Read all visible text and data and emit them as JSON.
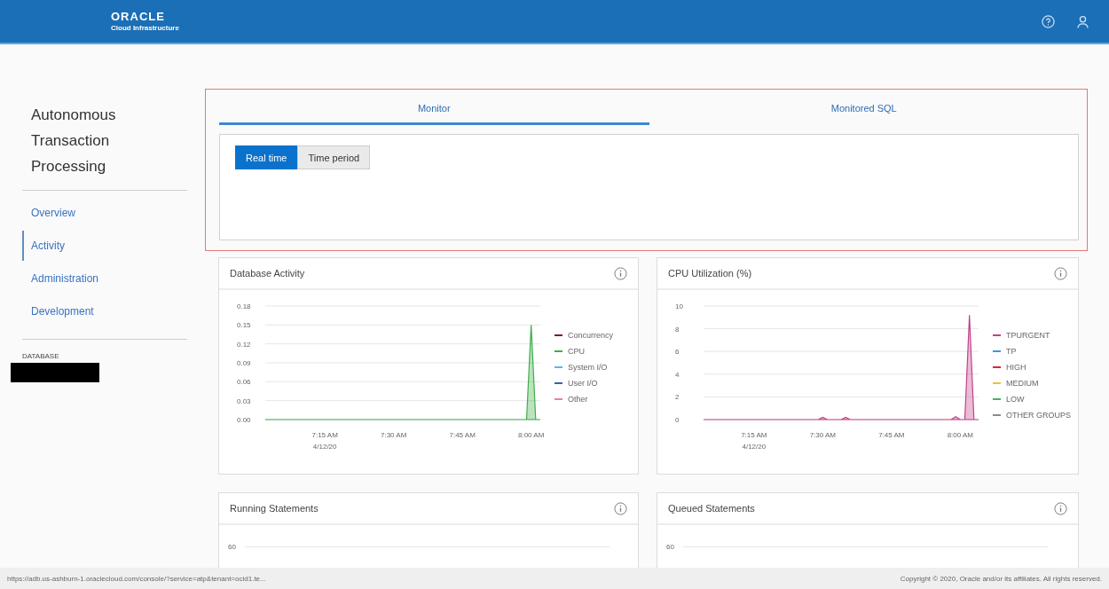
{
  "header": {
    "logo": "ORACLE",
    "logo_subtitle": "Cloud Infrastructure"
  },
  "sidebar": {
    "title": "Autonomous Transaction Processing",
    "items": [
      {
        "label": "Overview",
        "selected": false
      },
      {
        "label": "Activity",
        "selected": true
      },
      {
        "label": "Administration",
        "selected": false
      },
      {
        "label": "Development",
        "selected": false
      }
    ],
    "database_label": "DATABASE"
  },
  "tabs": [
    {
      "label": "Monitor",
      "selected": true
    },
    {
      "label": "Monitored SQL",
      "selected": false
    }
  ],
  "mode_buttons": [
    {
      "label": "Real time",
      "selected": true
    },
    {
      "label": "Time period",
      "selected": false
    }
  ],
  "charts": [
    {
      "title": "Database Activity",
      "date_label": "4/12/20",
      "legend": [
        {
          "kind": "static",
          "label": "Concurrency",
          "color": "#7a1f1f"
        },
        {
          "kind": "series"
        },
        {
          "kind": "static",
          "label": "System I/O",
          "color": "#5ab4e6"
        },
        {
          "kind": "static",
          "label": "User I/O",
          "color": "#3c5fb0"
        },
        {
          "kind": "static",
          "label": "Other",
          "color": "#e8829c"
        }
      ],
      "chart_data": {
        "type": "area",
        "grid": true,
        "ylim": [
          0,
          0.18
        ],
        "yticks": [
          {
            "value": 0,
            "label": "0.00"
          },
          {
            "value": 0.03,
            "label": "0.03"
          },
          {
            "value": 0.06,
            "label": "0.06"
          },
          {
            "value": 0.09,
            "label": "0.09"
          },
          {
            "value": 0.12,
            "label": "0.12"
          },
          {
            "value": 0.15,
            "label": "0.15"
          },
          {
            "value": 0.18,
            "label": "0.18"
          }
        ],
        "categories": [
          null,
          null,
          null,
          null,
          null,
          null,
          null,
          null,
          null,
          null,
          null,
          null,
          null,
          "7:15 AM",
          null,
          null,
          null,
          null,
          null,
          null,
          null,
          null,
          null,
          null,
          null,
          null,
          null,
          null,
          "7:30 AM",
          null,
          null,
          null,
          null,
          null,
          null,
          null,
          null,
          null,
          null,
          null,
          null,
          null,
          null,
          "7:45 AM",
          null,
          null,
          null,
          null,
          null,
          null,
          null,
          null,
          null,
          null,
          null,
          null,
          null,
          null,
          "8:00 AM",
          null,
          null
        ],
        "series": [
          {
            "name": "CPU",
            "color": "#3fae49",
            "values": [
              0,
              0,
              0,
              0,
              0,
              0,
              0,
              0,
              0,
              0,
              0,
              0,
              0,
              0,
              0,
              0,
              0,
              0,
              0,
              0,
              0,
              0,
              0,
              0,
              0,
              0,
              0,
              0,
              0,
              0,
              0,
              0,
              0,
              0,
              0,
              0,
              0,
              0,
              0,
              0,
              0,
              0,
              0,
              0,
              0,
              0,
              0,
              0,
              0,
              0,
              0,
              0,
              0,
              0,
              0,
              0,
              0,
              0,
              0.15,
              0,
              0
            ]
          }
        ]
      }
    },
    {
      "title": "CPU Utilization (%)",
      "date_label": "4/12/20",
      "legend": [
        {
          "kind": "series"
        },
        {
          "kind": "static",
          "label": "TP",
          "color": "#3a9ad9"
        },
        {
          "kind": "static",
          "label": "HIGH",
          "color": "#d9263a"
        },
        {
          "kind": "static",
          "label": "MEDIUM",
          "color": "#f2c230"
        },
        {
          "kind": "static",
          "label": "LOW",
          "color": "#4cae5a"
        },
        {
          "kind": "static",
          "label": "OTHER GROUPS",
          "color": "#8a8a8a"
        }
      ],
      "chart_data": {
        "type": "area",
        "grid": true,
        "ylim": [
          0,
          10
        ],
        "yticks": [
          0,
          2,
          4,
          6,
          8,
          10
        ],
        "categories": [
          null,
          null,
          null,
          null,
          null,
          null,
          null,
          null,
          null,
          null,
          null,
          "7:15 AM",
          null,
          null,
          null,
          null,
          null,
          null,
          null,
          null,
          null,
          null,
          null,
          null,
          null,
          null,
          "7:30 AM",
          null,
          null,
          null,
          null,
          null,
          null,
          null,
          null,
          null,
          null,
          null,
          null,
          null,
          null,
          "7:45 AM",
          null,
          null,
          null,
          null,
          null,
          null,
          null,
          null,
          null,
          null,
          null,
          null,
          null,
          null,
          "8:00 AM",
          null,
          null,
          null,
          null
        ],
        "series": [
          {
            "name": "TPURGENT",
            "color": "#c2408a",
            "values": [
              0,
              0,
              0,
              0,
              0,
              0,
              0,
              0,
              0,
              0,
              0,
              0,
              0,
              0,
              0,
              0,
              0,
              0,
              0,
              0,
              0,
              0,
              0,
              0,
              0,
              0,
              0.2,
              0,
              0,
              0,
              0,
              0.2,
              0,
              0,
              0,
              0,
              0,
              0,
              0,
              0,
              0,
              0,
              0,
              0,
              0,
              0,
              0,
              0,
              0,
              0,
              0,
              0,
              0,
              0,
              0,
              0.25,
              0,
              0,
              9.2,
              0,
              0
            ]
          }
        ]
      }
    },
    {
      "title": "Running Statements",
      "top_tick": "60"
    },
    {
      "title": "Queued Statements",
      "top_tick": "60"
    }
  ],
  "status_bar": {
    "url": "https://adb.us-ashburn-1.oraclecloud.com/console/?service=atp&tenant=ocid1.te...",
    "copyright": "Copyright © 2020, Oracle and/or its affiliates. All rights reserved."
  }
}
